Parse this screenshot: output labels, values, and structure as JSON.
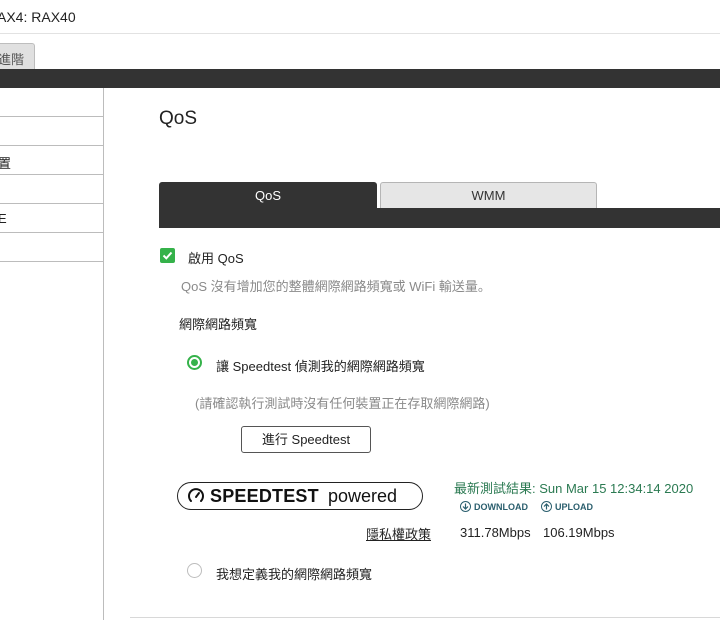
{
  "window": {
    "title": "AX4: RAX40"
  },
  "top_tabs": [
    {
      "label": "進階"
    }
  ],
  "sidebar": {
    "items": [
      {
        "label": ""
      },
      {
        "label": ""
      },
      {
        "label": "置"
      },
      {
        "label": ""
      },
      {
        "label": "E"
      },
      {
        "label": ""
      }
    ]
  },
  "page": {
    "title": "QoS"
  },
  "tabs": [
    {
      "label": "QoS"
    },
    {
      "label": "WMM"
    }
  ],
  "qos": {
    "enable_label": "啟用 QoS",
    "enable_checked": true,
    "description": "QoS 沒有增加您的整體網際網路頻寬或 WiFi 輸送量。",
    "bandwidth_label": "網際網路頻寬",
    "option_speedtest": "讓 Speedtest 偵測我的網際網路頻寬",
    "note": "(請確認執行測試時沒有任何裝置正在存取網際網路)",
    "run_button": "進行 Speedtest",
    "option_custom": "我想定義我的網際網路頻寬"
  },
  "speedtest": {
    "logo_word": "SPEEDTEST",
    "logo_powered": "powered",
    "privacy_link": "隱私權政策",
    "latest_result": "最新測試結果: Sun Mar 15 12:34:14 2020",
    "download_label": "DOWNLOAD",
    "upload_label": "UPLOAD",
    "download_value": "311.78Mbps",
    "upload_value": "106.19Mbps"
  },
  "colors": {
    "accent": "#35b24a",
    "dark_bar": "#333333",
    "result_text": "#2b7a52",
    "speed_head": "#2b5f6e"
  }
}
